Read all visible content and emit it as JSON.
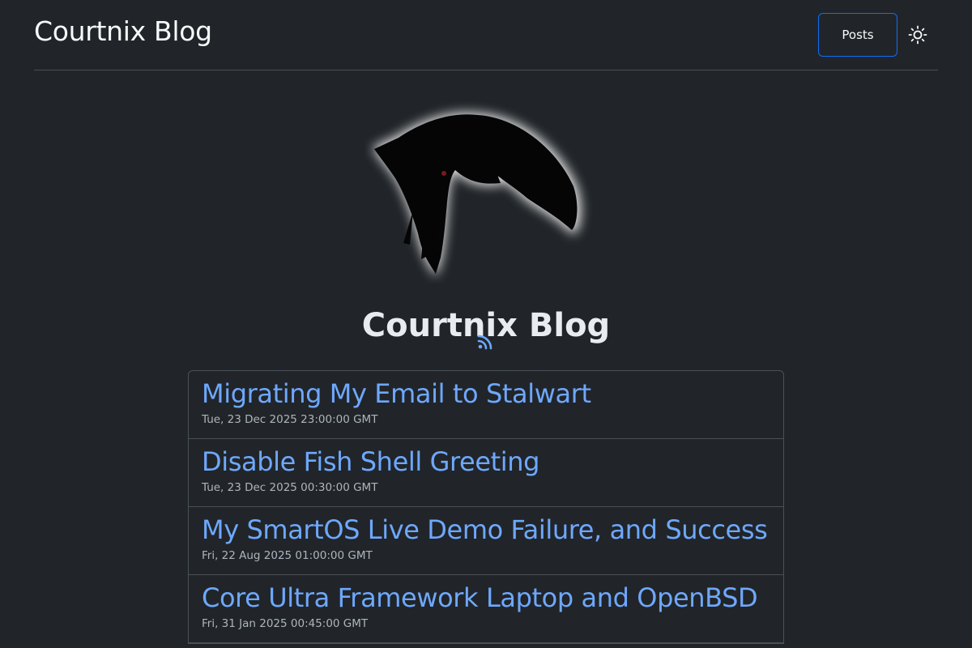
{
  "navbar": {
    "brand": "Courtnix Blog",
    "posts_label": "Posts",
    "theme_toggle_icon": "sun-icon"
  },
  "hero": {
    "logo_icon": "crow-logo",
    "title": "Courtnix Blog",
    "feed_icon": "rss-icon"
  },
  "colors": {
    "background": "#212529",
    "link": "#6ea8fe",
    "button_border": "#0d6efd",
    "border": "#495057"
  },
  "posts": [
    {
      "title": "Migrating My Email to Stalwart",
      "date": "Tue, 23 Dec 2025 23:00:00 GMT"
    },
    {
      "title": "Disable Fish Shell Greeting",
      "date": "Tue, 23 Dec 2025 00:30:00 GMT"
    },
    {
      "title": "My SmartOS Live Demo Failure, and Success",
      "date": "Fri, 22 Aug 2025 01:00:00 GMT"
    },
    {
      "title": "Core Ultra Framework Laptop and OpenBSD",
      "date": "Fri, 31 Jan 2025 00:45:00 GMT"
    }
  ]
}
